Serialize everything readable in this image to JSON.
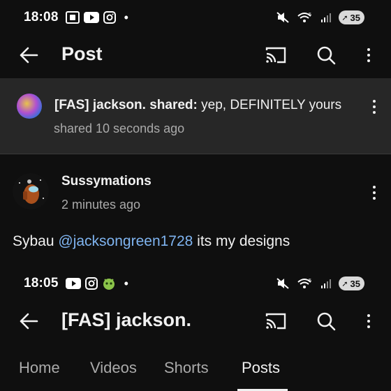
{
  "screen1": {
    "status": {
      "time": "18:08",
      "battery": "35"
    },
    "header": {
      "title": "Post"
    },
    "shared": {
      "author": "[FAS] jackson. shared:",
      "message": " yep, DEFINITELY yours",
      "time": "shared 10 seconds ago"
    },
    "post": {
      "author": "Sussymations",
      "time": "2 minutes ago",
      "text_before": "Sybau ",
      "mention": "@jacksongreen1728",
      "text_after": " its my designs"
    }
  },
  "screen2": {
    "status": {
      "time": "18:05",
      "battery": "35"
    },
    "header": {
      "title": "[FAS] jackson."
    },
    "tabs": [
      {
        "label": "Home"
      },
      {
        "label": "Videos"
      },
      {
        "label": "Shorts"
      },
      {
        "label": "Posts"
      }
    ]
  },
  "colors": {
    "background": "#0f0f0f",
    "card": "#272727",
    "link": "#7fb4f0",
    "secondary_text": "#aaaaaa"
  }
}
